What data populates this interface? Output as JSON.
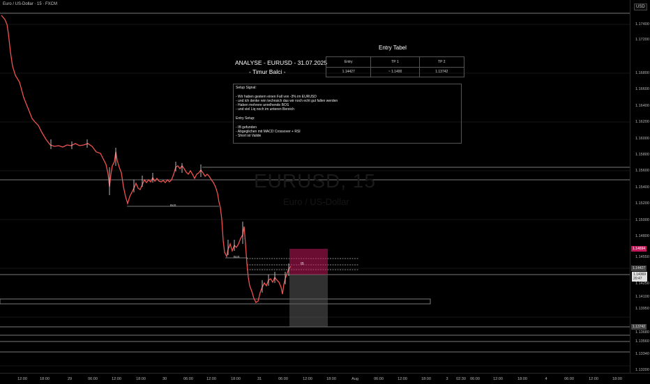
{
  "window": {
    "title": "Euro / US-Dollar · 15 · FXCM",
    "currency": "USD"
  },
  "watermark": {
    "symbol": "EURUSD, 15",
    "name": "Euro / US-Dollar"
  },
  "headline": {
    "title": "ANALYSE - EURUSD - 31.07.2025",
    "author": "- Timur Balci -"
  },
  "entry_table": {
    "title": "Entry Tabel",
    "headers": [
      "Entry",
      "TP 1",
      "TP 2"
    ],
    "values": [
      "1.14427",
      "~ 1.1400",
      "1.13742"
    ]
  },
  "setup_notes": [
    "Setup Signal:",
    "",
    "- Wir haben gestern einen Fall von -3% im EURUSD",
    "- und ich denke rein technsich das wir noch echt gut fallen werden",
    "- Haben mehrere anrelhende BOS",
    "- und viel Liq noch im unteren Bereich",
    "",
    "Entry Setup:",
    "",
    "- IB gefunden",
    "- Abgeglichen mit MACD Crossover + RSI",
    "- Short ist Valide"
  ],
  "annotations": {
    "bos1": "BoS",
    "bos2": "BoS",
    "fvg": "IB"
  },
  "price_axis": [
    "1.17400",
    "1.17200",
    "1.16800",
    "1.16600",
    "1.16400",
    "1.16200",
    "1.16000",
    "1.15800",
    "1.15600",
    "1.15400",
    "1.15200",
    "1.15000",
    "1.14800",
    "1.14550",
    "1.14250",
    "1.14100",
    "1.13950",
    "1.13680",
    "1.13560",
    "1.13340",
    "1.13200"
  ],
  "price_tags": {
    "red": "1.14694",
    "gray": "1.14427",
    "white_price": "1.14369",
    "white_timer": "20:47",
    "tp2": "1.13742"
  },
  "time_axis": [
    "12:00",
    "18:00",
    "29",
    "06:00",
    "12:00",
    "18:00",
    "30",
    "06:00",
    "12:00",
    "18:00",
    "31",
    "06:00",
    "12:00",
    "18:00",
    "Aug",
    "06:00",
    "12:00",
    "18:00",
    "3",
    "02:30",
    "06:00",
    "12:00",
    "18:00",
    "4",
    "06:00",
    "12:00",
    "18:00",
    "5",
    "06:00",
    "12:00",
    "18:00"
  ],
  "colors": {
    "background": "#000000",
    "candle_bear": "#ef5350",
    "candle_bull": "#e6e6e6",
    "stop_zone": "#c2185b",
    "target_zone": "#5a5a5a"
  }
}
